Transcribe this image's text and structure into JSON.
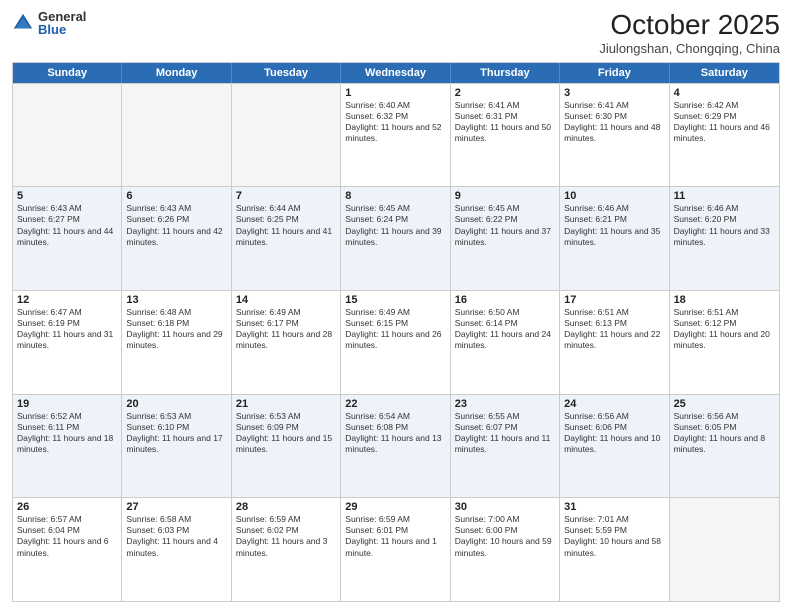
{
  "header": {
    "logo_general": "General",
    "logo_blue": "Blue",
    "title": "October 2025",
    "location": "Jiulongshan, Chongqing, China"
  },
  "days_of_week": [
    "Sunday",
    "Monday",
    "Tuesday",
    "Wednesday",
    "Thursday",
    "Friday",
    "Saturday"
  ],
  "rows": [
    {
      "alt": false,
      "cells": [
        {
          "day": "",
          "sunrise": "",
          "sunset": "",
          "daylight": "",
          "empty": true
        },
        {
          "day": "",
          "sunrise": "",
          "sunset": "",
          "daylight": "",
          "empty": true
        },
        {
          "day": "",
          "sunrise": "",
          "sunset": "",
          "daylight": "",
          "empty": true
        },
        {
          "day": "1",
          "sunrise": "Sunrise: 6:40 AM",
          "sunset": "Sunset: 6:32 PM",
          "daylight": "Daylight: 11 hours and 52 minutes."
        },
        {
          "day": "2",
          "sunrise": "Sunrise: 6:41 AM",
          "sunset": "Sunset: 6:31 PM",
          "daylight": "Daylight: 11 hours and 50 minutes."
        },
        {
          "day": "3",
          "sunrise": "Sunrise: 6:41 AM",
          "sunset": "Sunset: 6:30 PM",
          "daylight": "Daylight: 11 hours and 48 minutes."
        },
        {
          "day": "4",
          "sunrise": "Sunrise: 6:42 AM",
          "sunset": "Sunset: 6:29 PM",
          "daylight": "Daylight: 11 hours and 46 minutes."
        }
      ]
    },
    {
      "alt": true,
      "cells": [
        {
          "day": "5",
          "sunrise": "Sunrise: 6:43 AM",
          "sunset": "Sunset: 6:27 PM",
          "daylight": "Daylight: 11 hours and 44 minutes."
        },
        {
          "day": "6",
          "sunrise": "Sunrise: 6:43 AM",
          "sunset": "Sunset: 6:26 PM",
          "daylight": "Daylight: 11 hours and 42 minutes."
        },
        {
          "day": "7",
          "sunrise": "Sunrise: 6:44 AM",
          "sunset": "Sunset: 6:25 PM",
          "daylight": "Daylight: 11 hours and 41 minutes."
        },
        {
          "day": "8",
          "sunrise": "Sunrise: 6:45 AM",
          "sunset": "Sunset: 6:24 PM",
          "daylight": "Daylight: 11 hours and 39 minutes."
        },
        {
          "day": "9",
          "sunrise": "Sunrise: 6:45 AM",
          "sunset": "Sunset: 6:22 PM",
          "daylight": "Daylight: 11 hours and 37 minutes."
        },
        {
          "day": "10",
          "sunrise": "Sunrise: 6:46 AM",
          "sunset": "Sunset: 6:21 PM",
          "daylight": "Daylight: 11 hours and 35 minutes."
        },
        {
          "day": "11",
          "sunrise": "Sunrise: 6:46 AM",
          "sunset": "Sunset: 6:20 PM",
          "daylight": "Daylight: 11 hours and 33 minutes."
        }
      ]
    },
    {
      "alt": false,
      "cells": [
        {
          "day": "12",
          "sunrise": "Sunrise: 6:47 AM",
          "sunset": "Sunset: 6:19 PM",
          "daylight": "Daylight: 11 hours and 31 minutes."
        },
        {
          "day": "13",
          "sunrise": "Sunrise: 6:48 AM",
          "sunset": "Sunset: 6:18 PM",
          "daylight": "Daylight: 11 hours and 29 minutes."
        },
        {
          "day": "14",
          "sunrise": "Sunrise: 6:49 AM",
          "sunset": "Sunset: 6:17 PM",
          "daylight": "Daylight: 11 hours and 28 minutes."
        },
        {
          "day": "15",
          "sunrise": "Sunrise: 6:49 AM",
          "sunset": "Sunset: 6:15 PM",
          "daylight": "Daylight: 11 hours and 26 minutes."
        },
        {
          "day": "16",
          "sunrise": "Sunrise: 6:50 AM",
          "sunset": "Sunset: 6:14 PM",
          "daylight": "Daylight: 11 hours and 24 minutes."
        },
        {
          "day": "17",
          "sunrise": "Sunrise: 6:51 AM",
          "sunset": "Sunset: 6:13 PM",
          "daylight": "Daylight: 11 hours and 22 minutes."
        },
        {
          "day": "18",
          "sunrise": "Sunrise: 6:51 AM",
          "sunset": "Sunset: 6:12 PM",
          "daylight": "Daylight: 11 hours and 20 minutes."
        }
      ]
    },
    {
      "alt": true,
      "cells": [
        {
          "day": "19",
          "sunrise": "Sunrise: 6:52 AM",
          "sunset": "Sunset: 6:11 PM",
          "daylight": "Daylight: 11 hours and 18 minutes."
        },
        {
          "day": "20",
          "sunrise": "Sunrise: 6:53 AM",
          "sunset": "Sunset: 6:10 PM",
          "daylight": "Daylight: 11 hours and 17 minutes."
        },
        {
          "day": "21",
          "sunrise": "Sunrise: 6:53 AM",
          "sunset": "Sunset: 6:09 PM",
          "daylight": "Daylight: 11 hours and 15 minutes."
        },
        {
          "day": "22",
          "sunrise": "Sunrise: 6:54 AM",
          "sunset": "Sunset: 6:08 PM",
          "daylight": "Daylight: 11 hours and 13 minutes."
        },
        {
          "day": "23",
          "sunrise": "Sunrise: 6:55 AM",
          "sunset": "Sunset: 6:07 PM",
          "daylight": "Daylight: 11 hours and 11 minutes."
        },
        {
          "day": "24",
          "sunrise": "Sunrise: 6:56 AM",
          "sunset": "Sunset: 6:06 PM",
          "daylight": "Daylight: 11 hours and 10 minutes."
        },
        {
          "day": "25",
          "sunrise": "Sunrise: 6:56 AM",
          "sunset": "Sunset: 6:05 PM",
          "daylight": "Daylight: 11 hours and 8 minutes."
        }
      ]
    },
    {
      "alt": false,
      "cells": [
        {
          "day": "26",
          "sunrise": "Sunrise: 6:57 AM",
          "sunset": "Sunset: 6:04 PM",
          "daylight": "Daylight: 11 hours and 6 minutes."
        },
        {
          "day": "27",
          "sunrise": "Sunrise: 6:58 AM",
          "sunset": "Sunset: 6:03 PM",
          "daylight": "Daylight: 11 hours and 4 minutes."
        },
        {
          "day": "28",
          "sunrise": "Sunrise: 6:59 AM",
          "sunset": "Sunset: 6:02 PM",
          "daylight": "Daylight: 11 hours and 3 minutes."
        },
        {
          "day": "29",
          "sunrise": "Sunrise: 6:59 AM",
          "sunset": "Sunset: 6:01 PM",
          "daylight": "Daylight: 11 hours and 1 minute."
        },
        {
          "day": "30",
          "sunrise": "Sunrise: 7:00 AM",
          "sunset": "Sunset: 6:00 PM",
          "daylight": "Daylight: 10 hours and 59 minutes."
        },
        {
          "day": "31",
          "sunrise": "Sunrise: 7:01 AM",
          "sunset": "Sunset: 5:59 PM",
          "daylight": "Daylight: 10 hours and 58 minutes."
        },
        {
          "day": "",
          "sunrise": "",
          "sunset": "",
          "daylight": "",
          "empty": true
        }
      ]
    }
  ]
}
